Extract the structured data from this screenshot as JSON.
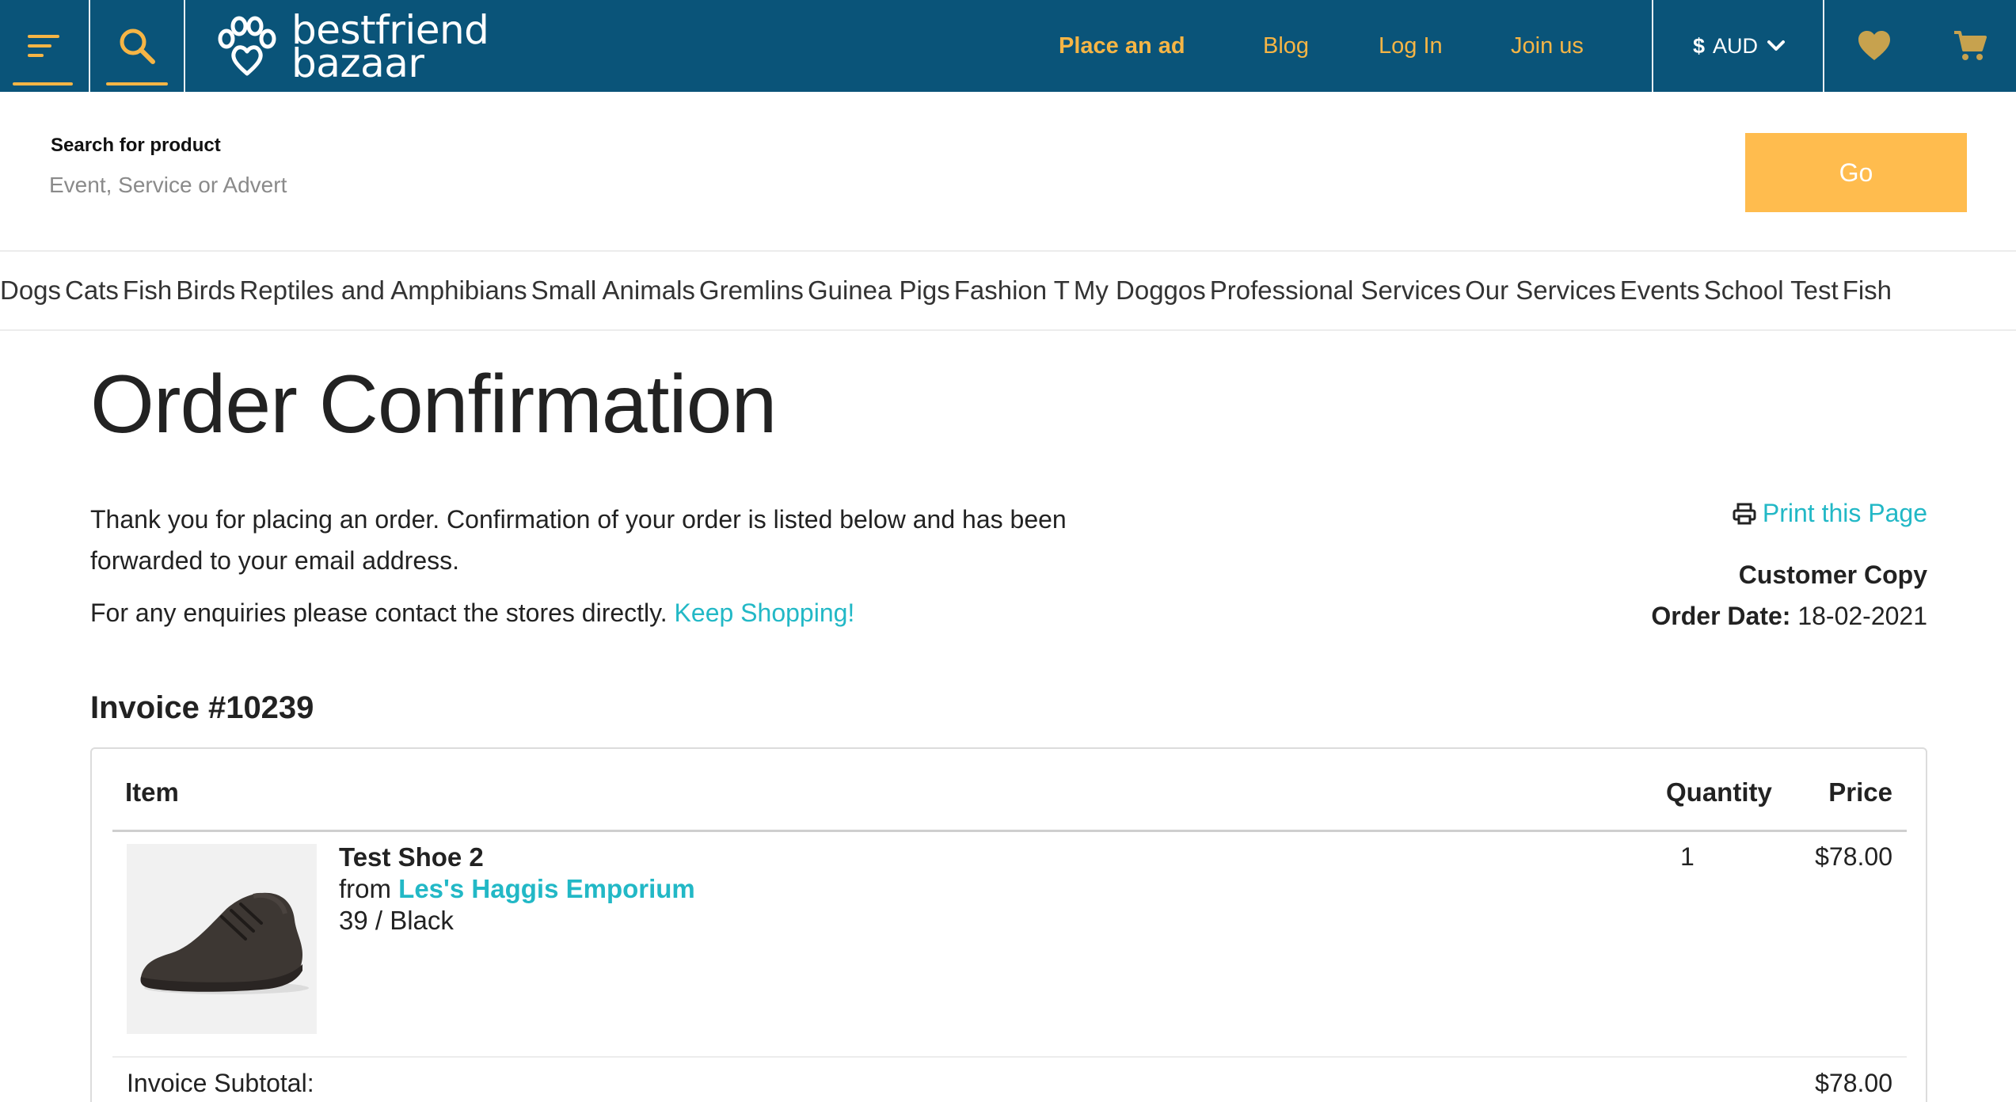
{
  "header": {
    "logo_line1": "bestfriend",
    "logo_line2": "bazaar",
    "nav": {
      "place_ad": "Place an ad",
      "blog": "Blog",
      "login": "Log In",
      "join": "Join us"
    },
    "currency": {
      "symbol": "$",
      "code": "AUD"
    },
    "icons": [
      "menu-icon",
      "search-icon",
      "paw-logo-icon",
      "chevron-down-icon",
      "heart-icon",
      "cart-icon"
    ],
    "colors": {
      "bar": "#0a5479",
      "accent": "#f6b545"
    }
  },
  "search": {
    "label": "Search for product",
    "placeholder": "Event, Service or Advert",
    "go_label": "Go"
  },
  "categories": [
    "Dogs",
    "Cats",
    "Fish",
    "Birds",
    "Reptiles and Amphibians",
    "Small Animals",
    "Gremlins",
    "Guinea Pigs",
    "Fashion T",
    "My Doggos",
    "Professional Services",
    "Our Services",
    "Events",
    "School Test",
    "Fish"
  ],
  "main": {
    "title": "Order Confirmation",
    "intro": "Thank you for placing an order. Confirmation of your order is listed below and has been forwarded to your email address.",
    "enquiry": "For any enquiries please contact the stores directly.",
    "keep_shopping": "Keep Shopping!",
    "print_label": "Print this Page",
    "customer_copy": "Customer Copy",
    "order_date_label": "Order Date:",
    "order_date": "18-02-2021",
    "invoice_title": "Invoice #10239",
    "table": {
      "headers": {
        "item": "Item",
        "quantity": "Quantity",
        "price": "Price"
      },
      "rows": [
        {
          "name": "Test Shoe 2",
          "from_label": "from",
          "store": "Les's Haggis Emporium",
          "variant": "39 / Black",
          "quantity": "1",
          "price": "$78.00"
        }
      ],
      "subtotal_label": "Invoice Subtotal:",
      "subtotal_value": "$78.00"
    },
    "link_color": "#22b8c6"
  }
}
